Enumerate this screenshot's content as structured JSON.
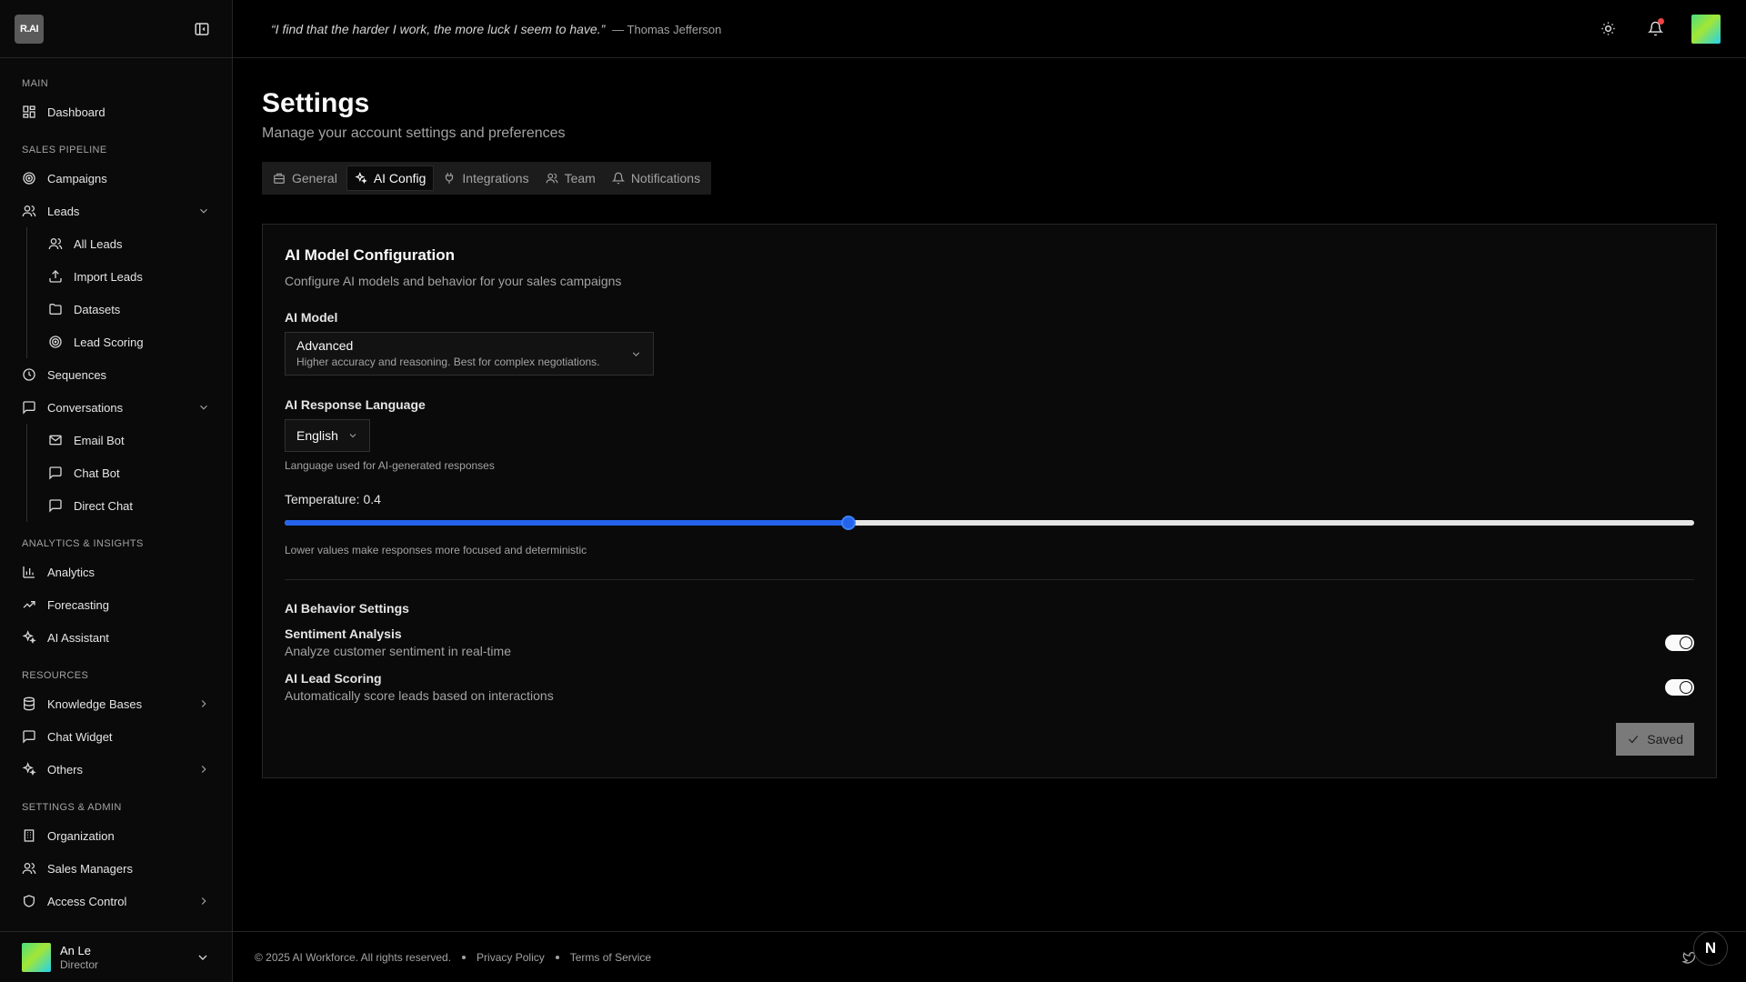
{
  "app": {
    "logo_text": "R.AI"
  },
  "sidebar": {
    "sections": {
      "main": "MAIN",
      "sales": "SALES PIPELINE",
      "analytics": "ANALYTICS & INSIGHTS",
      "resources": "RESOURCES",
      "settings": "SETTINGS & ADMIN"
    },
    "items": {
      "dashboard": "Dashboard",
      "campaigns": "Campaigns",
      "leads": "Leads",
      "all_leads": "All Leads",
      "import_leads": "Import Leads",
      "datasets": "Datasets",
      "lead_scoring": "Lead Scoring",
      "sequences": "Sequences",
      "conversations": "Conversations",
      "email_bot": "Email Bot",
      "chat_bot": "Chat Bot",
      "direct_chat": "Direct Chat",
      "analytics": "Analytics",
      "forecasting": "Forecasting",
      "ai_assistant": "AI Assistant",
      "knowledge_bases": "Knowledge Bases",
      "chat_widget": "Chat Widget",
      "others": "Others",
      "organization": "Organization",
      "sales_managers": "Sales Managers",
      "access_control": "Access Control"
    },
    "user": {
      "name": "An Le",
      "role": "Director"
    }
  },
  "header": {
    "quote": "“I find that the harder I work, the more luck I seem to have.”",
    "author": "— Thomas Jefferson"
  },
  "page": {
    "title": "Settings",
    "subtitle": "Manage your account settings and preferences",
    "tabs": {
      "general": "General",
      "ai_config": "AI Config",
      "integrations": "Integrations",
      "team": "Team",
      "notifications": "Notifications"
    },
    "active_tab": "AI Config"
  },
  "ai_config": {
    "title": "AI Model Configuration",
    "description": "Configure AI models and behavior for your sales campaigns",
    "model_label": "AI Model",
    "model_value": "Advanced",
    "model_description": "Higher accuracy and reasoning. Best for complex negotiations.",
    "language_label": "AI Response Language",
    "language_value": "English",
    "language_hint": "Language used for AI-generated responses",
    "temperature_label": "Temperature:",
    "temperature_value": "0.4",
    "temperature_fraction": 0.4,
    "temperature_hint": "Lower values make responses more focused and deterministic",
    "behavior_title": "AI Behavior Settings",
    "sentiment_name": "Sentiment Analysis",
    "sentiment_desc": "Analyze customer sentiment in real-time",
    "sentiment_enabled": true,
    "lead_scoring_name": "AI Lead Scoring",
    "lead_scoring_desc": "Automatically score leads based on interactions",
    "lead_scoring_enabled": true,
    "save_label": "Saved"
  },
  "footer": {
    "copyright": "© 2025 AI Workforce. All rights reserved.",
    "privacy": "Privacy Policy",
    "terms": "Terms of Service",
    "badge": "N"
  },
  "colors": {
    "background": "#000000",
    "accent": "#2563eb",
    "notification_dot": "#ef4444"
  }
}
